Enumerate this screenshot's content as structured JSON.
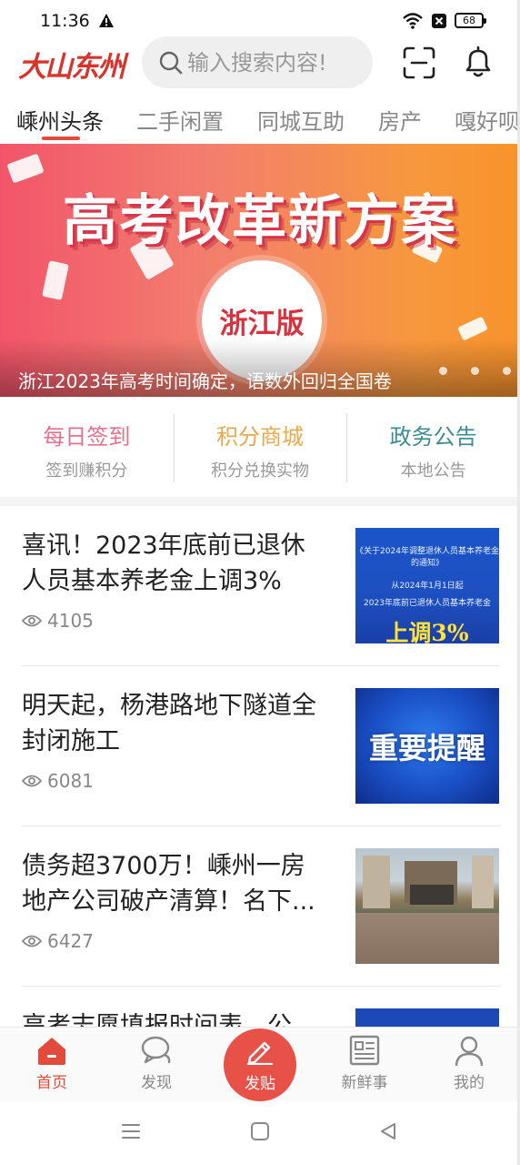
{
  "status_bar": {
    "time": "11:36",
    "battery": "68"
  },
  "header": {
    "logo_text": "大山东州",
    "search_placeholder": "输入搜索内容!"
  },
  "tabs": [
    {
      "label": "嵊州头条",
      "active": true
    },
    {
      "label": "二手闲置",
      "active": false
    },
    {
      "label": "同城互助",
      "active": false
    },
    {
      "label": "房产",
      "active": false
    },
    {
      "label": "嘎好呗",
      "active": false
    }
  ],
  "banner": {
    "headline": "高考改革新方案",
    "badge": "浙江版",
    "caption": "浙江2023年高考时间确定，语数外回归全国卷",
    "dot_count": 3
  },
  "quick_entries": [
    {
      "title": "每日签到",
      "subtitle": "签到赚积分",
      "color": "#e8708a"
    },
    {
      "title": "积分商城",
      "subtitle": "积分兑换实物",
      "color": "#e9a94a"
    },
    {
      "title": "政务公告",
      "subtitle": "本地公告",
      "color": "#3b8c93"
    }
  ],
  "news": [
    {
      "title": "喜讯！2023年底前已退休人员基本养老金上调3%",
      "views": "4105",
      "thumb": {
        "type": "notice",
        "line1": "《关于2024年调整退休人员基本养老金的通知》",
        "line2": "从2024年1月1日起",
        "line3": "2023年底前已退休人员基本养老金",
        "line4": "上调3%"
      }
    },
    {
      "title": "明天起，杨港路地下隧道全封闭施工",
      "views": "6081",
      "thumb": {
        "type": "remind",
        "text": "重要提醒"
      }
    },
    {
      "title": "债务超3700万！嵊州一房地产公司破产清算！名下...",
      "views": "6427",
      "thumb": {
        "type": "photo"
      }
    },
    {
      "title": "高考志愿填报时间表，公",
      "views": "",
      "thumb": {
        "type": "partial"
      }
    }
  ],
  "tabbar": [
    {
      "label": "首页",
      "icon": "home-icon",
      "active": true
    },
    {
      "label": "发现",
      "icon": "chat-bubbles-icon",
      "active": false
    },
    {
      "label": "发贴",
      "icon": "pen-icon",
      "active": false
    },
    {
      "label": "新鲜事",
      "icon": "newspaper-icon",
      "active": false
    },
    {
      "label": "我的",
      "icon": "user-icon",
      "active": false
    }
  ],
  "colors": {
    "accent": "#e24a3b",
    "post_button": "#e85148"
  }
}
